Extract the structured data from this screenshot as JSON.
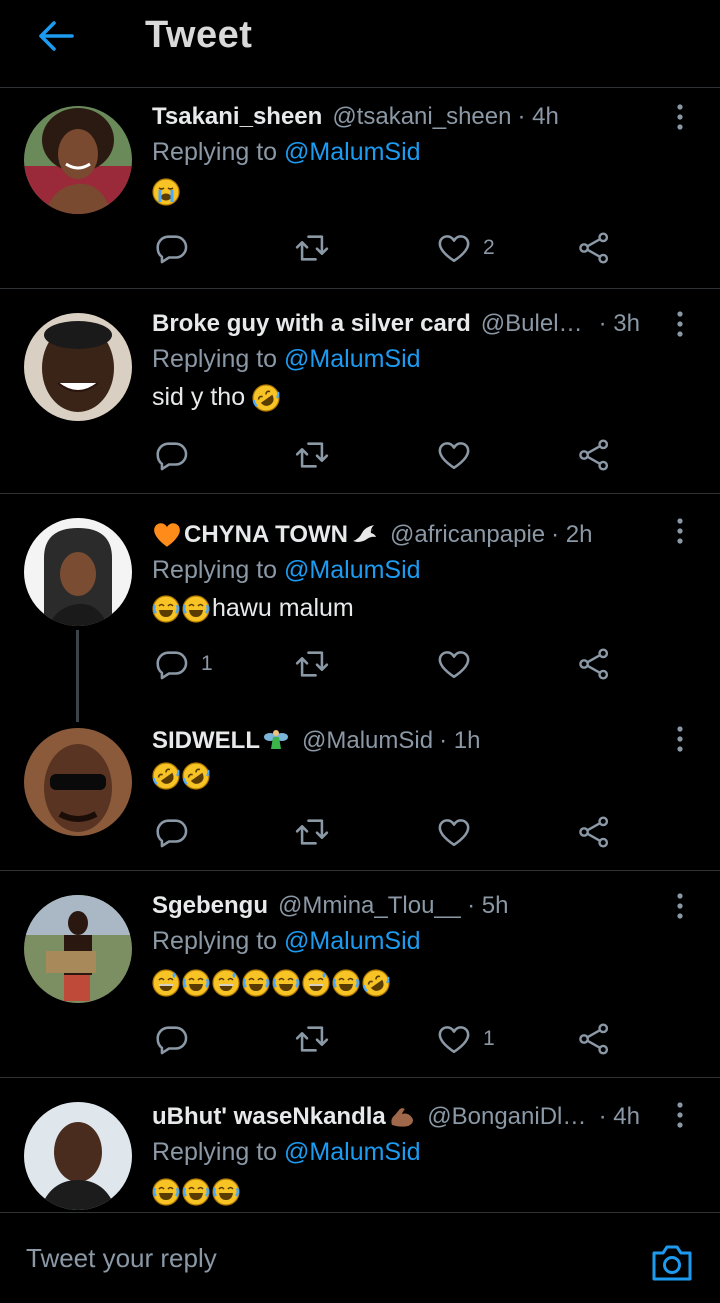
{
  "header": {
    "title": "Tweet"
  },
  "replying_prefix": "Replying to",
  "tweets": [
    {
      "name": "Tsakani_sheen",
      "handle": "@tsakani_sheen",
      "time": "· 4h",
      "reply_to": "@MalumSid",
      "text": "",
      "emojis": [
        "crying"
      ],
      "reply_count": "",
      "like_count": "2"
    },
    {
      "name": "Broke guy with a silver card",
      "handle": "@BulelaL...",
      "time": "· 3h",
      "reply_to": "@MalumSid",
      "text": "sid y tho",
      "emojis": [
        "rofl"
      ],
      "reply_count": "",
      "like_count": ""
    },
    {
      "name": "CHYNA TOWN",
      "handle": "@africanpapie",
      "time": "· 2h",
      "reply_to": "@MalumSid",
      "text": "hawu malum",
      "emojis": [
        "joy",
        "joy"
      ],
      "reply_count": "1",
      "like_count": ""
    },
    {
      "name": "SIDWELL",
      "handle": "@MalumSid",
      "time": "· 1h",
      "reply_to": "",
      "text": "",
      "emojis": [
        "rofl",
        "rofl"
      ],
      "reply_count": "",
      "like_count": ""
    },
    {
      "name": "Sgebengu",
      "handle": "@Mmina_Tlou__",
      "time": "· 5h",
      "reply_to": "@MalumSid",
      "text": "",
      "emojis": [
        "grin-sweat",
        "joy",
        "grin-sweat",
        "joy",
        "joy",
        "grin-sweat",
        "joy",
        "rofl"
      ],
      "reply_count": "",
      "like_count": "1"
    },
    {
      "name": "uBhut' waseNkandla",
      "handle": "@BonganiDlo...",
      "time": "· 4h",
      "reply_to": "@MalumSid",
      "text": "",
      "emojis": [
        "joy",
        "joy",
        "joy"
      ],
      "reply_count": "",
      "like_count": ""
    }
  ],
  "name_emojis": {
    "chyna_heart": "orange-heart",
    "chyna_dove": "dove",
    "sidwell": "fairy",
    "ubhut": "flexed-biceps"
  },
  "reply_bar": {
    "placeholder": "Tweet your reply"
  },
  "colors": {
    "accent": "#1d9bf0",
    "background": "#000000",
    "muted": "#8b98a5",
    "divider": "#2f3336"
  },
  "icons": [
    "back-arrow-icon",
    "more-vertical-icon",
    "reply-icon",
    "retweet-icon",
    "like-icon",
    "share-icon",
    "camera-icon"
  ]
}
